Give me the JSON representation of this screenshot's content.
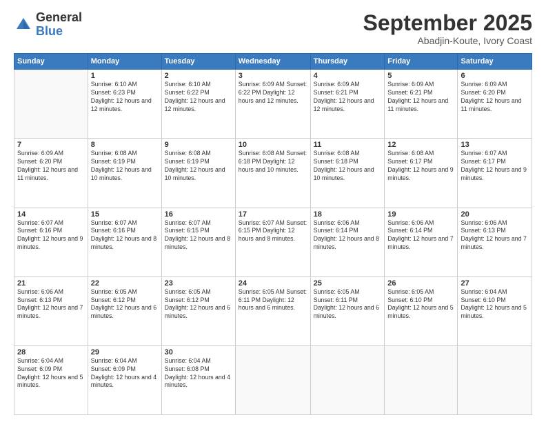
{
  "header": {
    "logo_general": "General",
    "logo_blue": "Blue",
    "month_title": "September 2025",
    "location": "Abadjin-Koute, Ivory Coast"
  },
  "days_of_week": [
    "Sunday",
    "Monday",
    "Tuesday",
    "Wednesday",
    "Thursday",
    "Friday",
    "Saturday"
  ],
  "weeks": [
    [
      {
        "day": "",
        "info": ""
      },
      {
        "day": "1",
        "info": "Sunrise: 6:10 AM\nSunset: 6:23 PM\nDaylight: 12 hours\nand 12 minutes."
      },
      {
        "day": "2",
        "info": "Sunrise: 6:10 AM\nSunset: 6:22 PM\nDaylight: 12 hours\nand 12 minutes."
      },
      {
        "day": "3",
        "info": "Sunrise: 6:09 AM\nSunset: 6:22 PM\nDaylight: 12 hours\nand 12 minutes."
      },
      {
        "day": "4",
        "info": "Sunrise: 6:09 AM\nSunset: 6:21 PM\nDaylight: 12 hours\nand 12 minutes."
      },
      {
        "day": "5",
        "info": "Sunrise: 6:09 AM\nSunset: 6:21 PM\nDaylight: 12 hours\nand 11 minutes."
      },
      {
        "day": "6",
        "info": "Sunrise: 6:09 AM\nSunset: 6:20 PM\nDaylight: 12 hours\nand 11 minutes."
      }
    ],
    [
      {
        "day": "7",
        "info": "Sunrise: 6:09 AM\nSunset: 6:20 PM\nDaylight: 12 hours\nand 11 minutes."
      },
      {
        "day": "8",
        "info": "Sunrise: 6:08 AM\nSunset: 6:19 PM\nDaylight: 12 hours\nand 10 minutes."
      },
      {
        "day": "9",
        "info": "Sunrise: 6:08 AM\nSunset: 6:19 PM\nDaylight: 12 hours\nand 10 minutes."
      },
      {
        "day": "10",
        "info": "Sunrise: 6:08 AM\nSunset: 6:18 PM\nDaylight: 12 hours\nand 10 minutes."
      },
      {
        "day": "11",
        "info": "Sunrise: 6:08 AM\nSunset: 6:18 PM\nDaylight: 12 hours\nand 10 minutes."
      },
      {
        "day": "12",
        "info": "Sunrise: 6:08 AM\nSunset: 6:17 PM\nDaylight: 12 hours\nand 9 minutes."
      },
      {
        "day": "13",
        "info": "Sunrise: 6:07 AM\nSunset: 6:17 PM\nDaylight: 12 hours\nand 9 minutes."
      }
    ],
    [
      {
        "day": "14",
        "info": "Sunrise: 6:07 AM\nSunset: 6:16 PM\nDaylight: 12 hours\nand 9 minutes."
      },
      {
        "day": "15",
        "info": "Sunrise: 6:07 AM\nSunset: 6:16 PM\nDaylight: 12 hours\nand 8 minutes."
      },
      {
        "day": "16",
        "info": "Sunrise: 6:07 AM\nSunset: 6:15 PM\nDaylight: 12 hours\nand 8 minutes."
      },
      {
        "day": "17",
        "info": "Sunrise: 6:07 AM\nSunset: 6:15 PM\nDaylight: 12 hours\nand 8 minutes."
      },
      {
        "day": "18",
        "info": "Sunrise: 6:06 AM\nSunset: 6:14 PM\nDaylight: 12 hours\nand 8 minutes."
      },
      {
        "day": "19",
        "info": "Sunrise: 6:06 AM\nSunset: 6:14 PM\nDaylight: 12 hours\nand 7 minutes."
      },
      {
        "day": "20",
        "info": "Sunrise: 6:06 AM\nSunset: 6:13 PM\nDaylight: 12 hours\nand 7 minutes."
      }
    ],
    [
      {
        "day": "21",
        "info": "Sunrise: 6:06 AM\nSunset: 6:13 PM\nDaylight: 12 hours\nand 7 minutes."
      },
      {
        "day": "22",
        "info": "Sunrise: 6:05 AM\nSunset: 6:12 PM\nDaylight: 12 hours\nand 6 minutes."
      },
      {
        "day": "23",
        "info": "Sunrise: 6:05 AM\nSunset: 6:12 PM\nDaylight: 12 hours\nand 6 minutes."
      },
      {
        "day": "24",
        "info": "Sunrise: 6:05 AM\nSunset: 6:11 PM\nDaylight: 12 hours\nand 6 minutes."
      },
      {
        "day": "25",
        "info": "Sunrise: 6:05 AM\nSunset: 6:11 PM\nDaylight: 12 hours\nand 6 minutes."
      },
      {
        "day": "26",
        "info": "Sunrise: 6:05 AM\nSunset: 6:10 PM\nDaylight: 12 hours\nand 5 minutes."
      },
      {
        "day": "27",
        "info": "Sunrise: 6:04 AM\nSunset: 6:10 PM\nDaylight: 12 hours\nand 5 minutes."
      }
    ],
    [
      {
        "day": "28",
        "info": "Sunrise: 6:04 AM\nSunset: 6:09 PM\nDaylight: 12 hours\nand 5 minutes."
      },
      {
        "day": "29",
        "info": "Sunrise: 6:04 AM\nSunset: 6:09 PM\nDaylight: 12 hours\nand 4 minutes."
      },
      {
        "day": "30",
        "info": "Sunrise: 6:04 AM\nSunset: 6:08 PM\nDaylight: 12 hours\nand 4 minutes."
      },
      {
        "day": "",
        "info": ""
      },
      {
        "day": "",
        "info": ""
      },
      {
        "day": "",
        "info": ""
      },
      {
        "day": "",
        "info": ""
      }
    ]
  ]
}
